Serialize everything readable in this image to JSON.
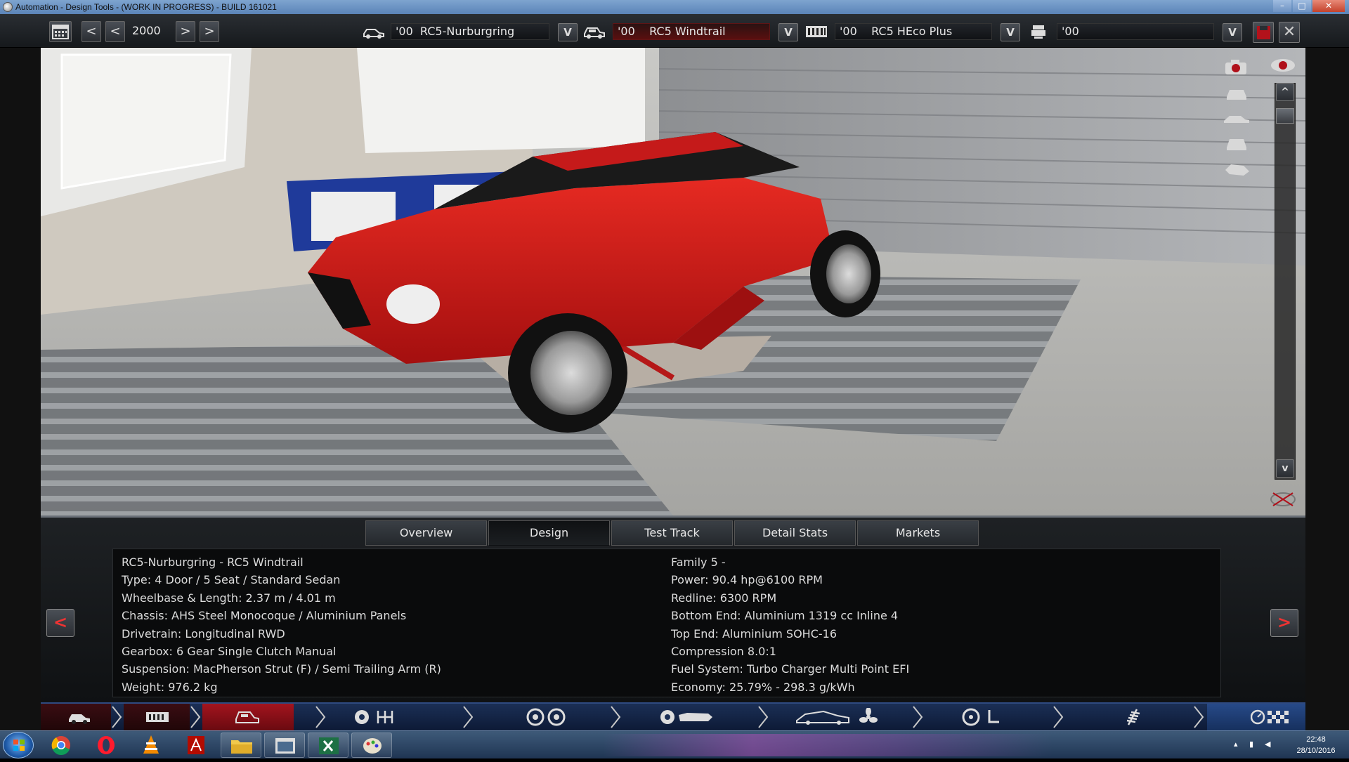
{
  "window": {
    "title": "Automation - Design Tools - (WORK IN PROGRESS) - BUILD 161021",
    "min_label": "–",
    "max_label": "□",
    "close_label": "✕"
  },
  "toolbar": {
    "prev_fast_label": "<",
    "prev_label": "<",
    "year": "2000",
    "next_label": ">",
    "next_fast_label": ">",
    "model": "'00  RC5-Nurburgring",
    "trim": "'00    RC5 Windtrail",
    "engine": "'00    RC5 HEco Plus",
    "variant": "'00",
    "dropdown_label": "V",
    "close_label": "✕"
  },
  "view_controls": {
    "scroll_up_label": "^",
    "scroll_down_label": "v"
  },
  "tabs": [
    "Overview",
    "Design",
    "Test Track",
    "Detail Stats",
    "Markets"
  ],
  "active_tab": "Design",
  "info_left": [
    "RC5-Nurburgring - RC5 Windtrail",
    "Type: 4 Door / 5 Seat / Standard Sedan",
    "Wheelbase & Length: 2.37 m / 4.01 m",
    "Chassis: AHS Steel Monocoque / Aluminium Panels",
    "Drivetrain: Longitudinal RWD",
    "Gearbox: 6 Gear Single Clutch Manual",
    "Suspension: MacPherson Strut (F) / Semi Trailing Arm (R)",
    "Weight: 976.2 kg"
  ],
  "info_right": [
    "Family 5 -",
    "Power: 90.4 hp@6100 RPM",
    "Redline: 6300 RPM",
    "Bottom End: Aluminium 1319 cc Inline 4",
    "Top End: Aluminium SOHC-16",
    "Compression 8.0:1",
    "Fuel System: Turbo Charger Multi Point EFI",
    "Economy: 25.79% - 298.3 g/kWh"
  ],
  "panel_nav": {
    "prev_label": "<",
    "next_label": ">"
  },
  "taskbar": {
    "time": "22:48",
    "date": "28/10/2016"
  },
  "colors": {
    "car_red": "#d41a1a",
    "accent_red": "#b3121b",
    "nav_blue": "#1b2f55"
  }
}
